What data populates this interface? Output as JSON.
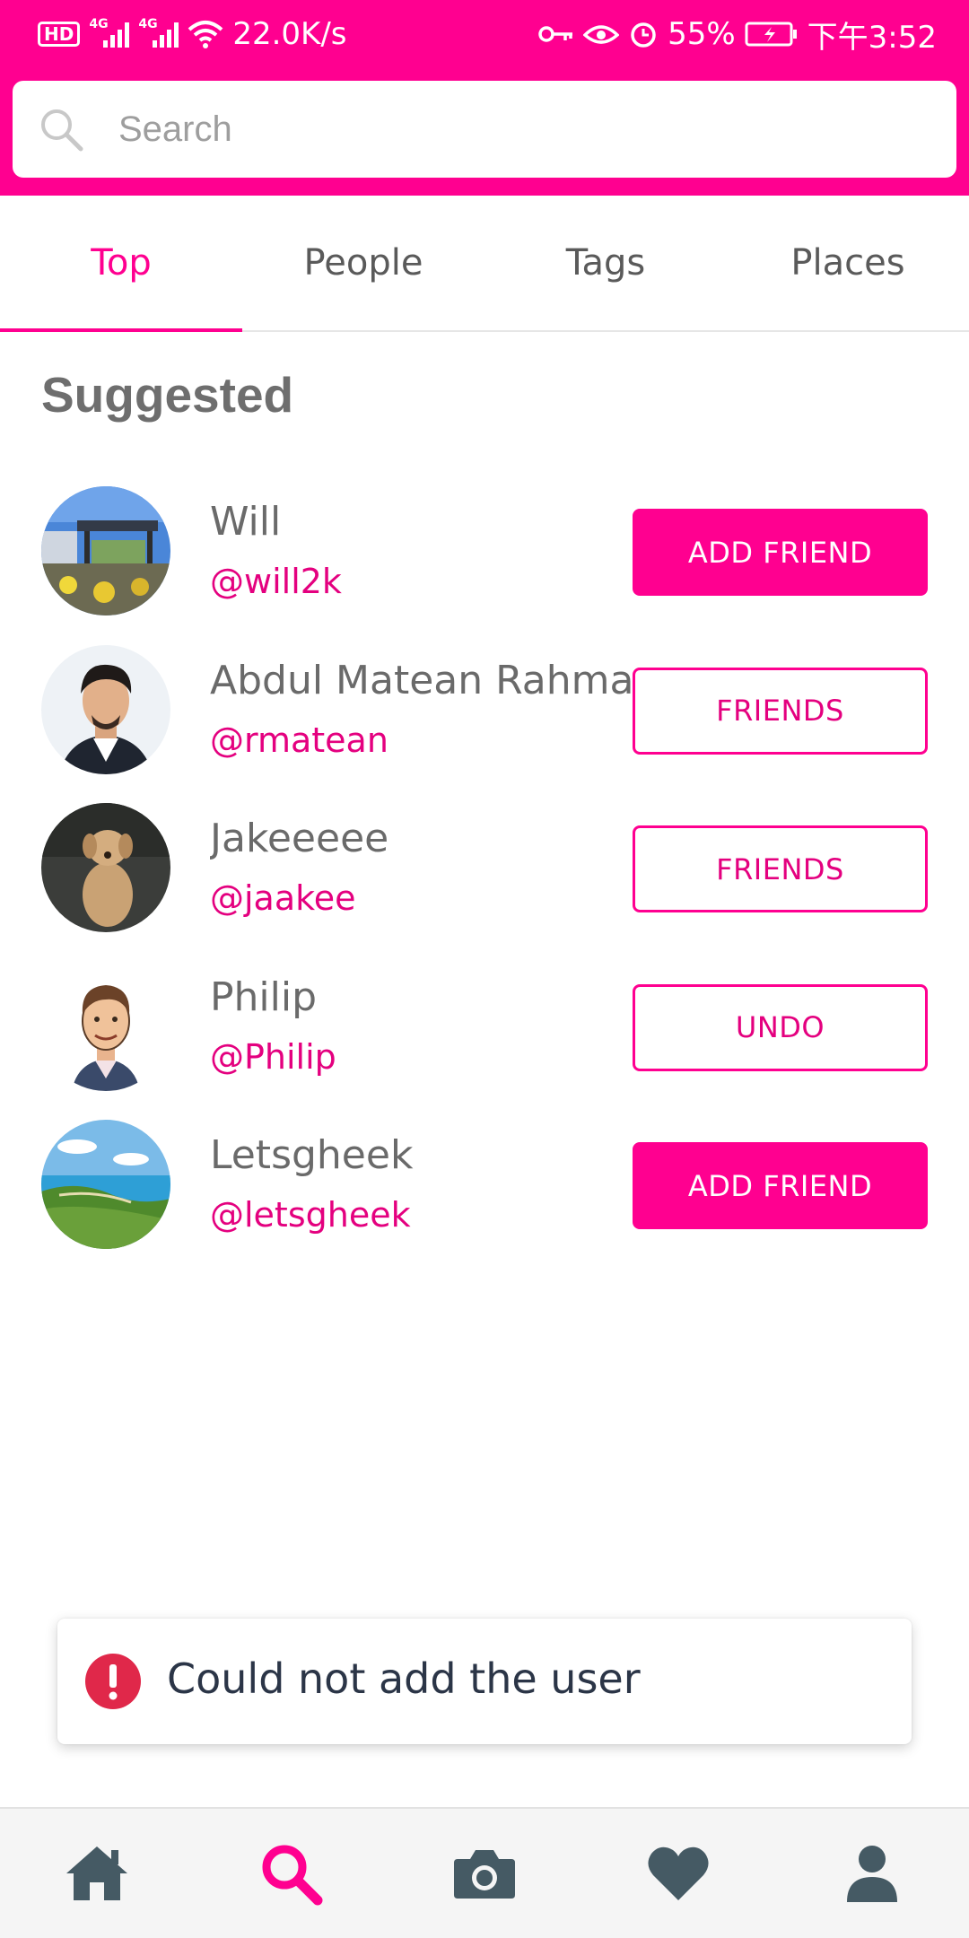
{
  "status_bar": {
    "hd": "HD",
    "net1": "4G",
    "net2": "4G",
    "speed": "22.0K/s",
    "battery": "55%",
    "time": "下午3:52"
  },
  "search": {
    "placeholder": "Search"
  },
  "tabs": [
    {
      "label": "Top",
      "active": true
    },
    {
      "label": "People"
    },
    {
      "label": "Tags"
    },
    {
      "label": "Places"
    }
  ],
  "section_title": "Suggested",
  "users": [
    {
      "name": "Will",
      "handle": "@will2k",
      "action": "ADD FRIEND",
      "style": "filled"
    },
    {
      "name": "Abdul Matean Rahman",
      "handle": "@rmatean",
      "action": "FRIENDS",
      "style": "outline"
    },
    {
      "name": "Jakeeeee",
      "handle": "@jaakee",
      "action": "FRIENDS",
      "style": "outline"
    },
    {
      "name": "Philip",
      "handle": "@Philip",
      "action": "UNDO",
      "style": "outline"
    },
    {
      "name": "Letsgheek",
      "handle": "@letsgheek",
      "action": "ADD FRIEND",
      "style": "filled"
    }
  ],
  "toast": {
    "message": "Could not add the user",
    "icon": "error-icon"
  },
  "bottom_nav": [
    "home-icon",
    "search-icon",
    "camera-icon",
    "heart-icon",
    "profile-icon"
  ],
  "colors": {
    "accent": "#FF0090",
    "handle": "#E4007F",
    "nav_icon": "#455A64",
    "error": "#E0284A"
  }
}
